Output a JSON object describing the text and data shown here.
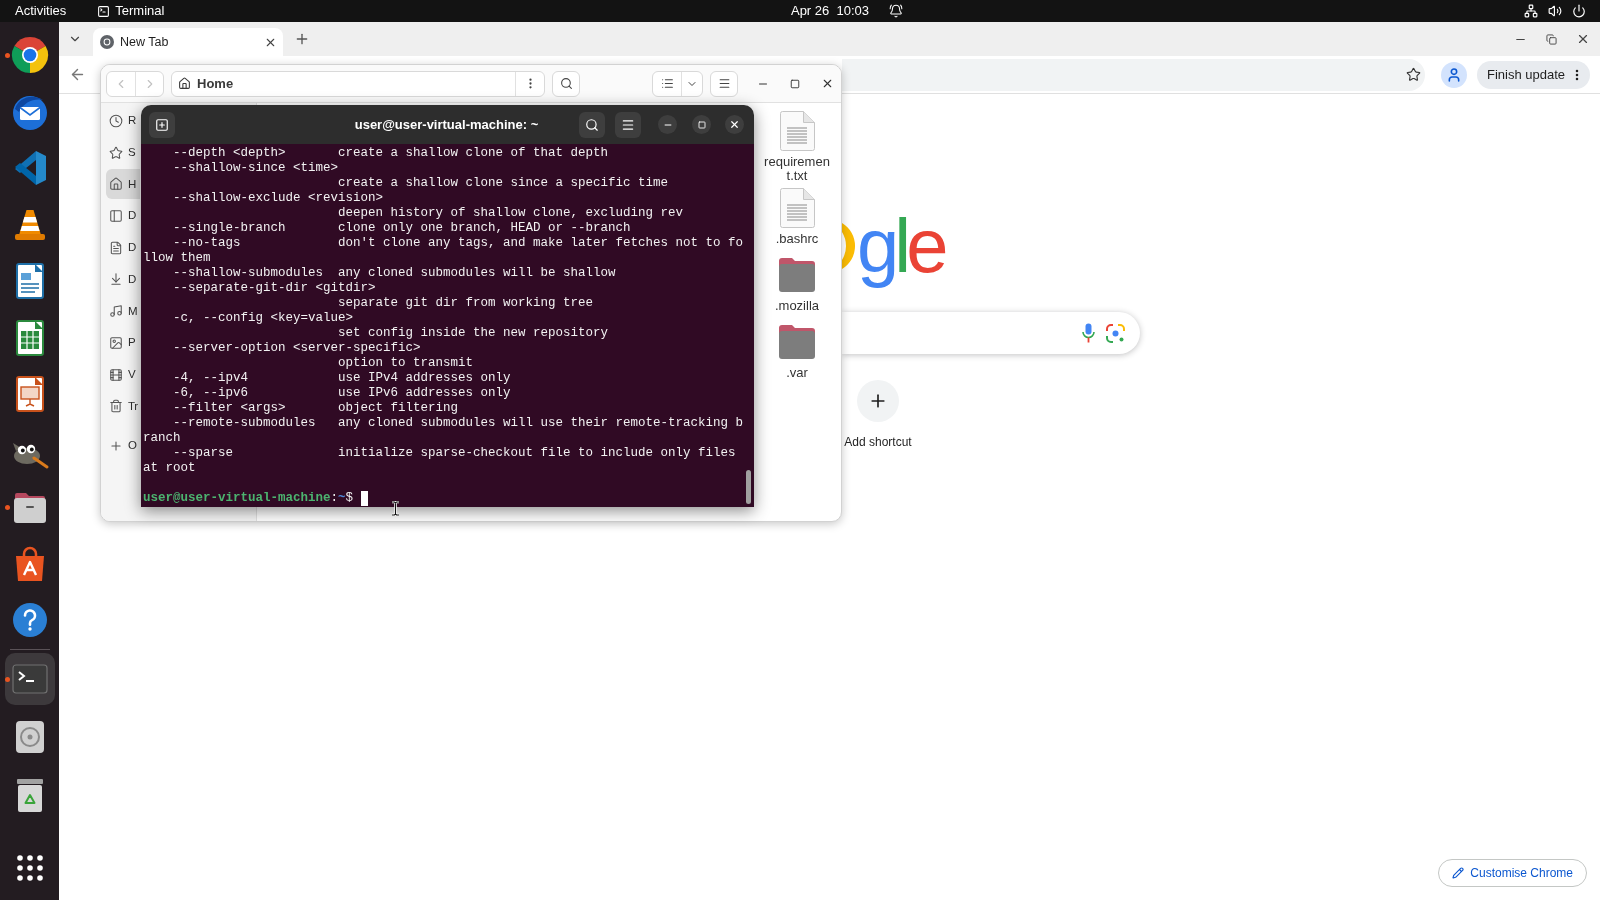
{
  "top_bar": {
    "activities": "Activities",
    "app_menu": "Terminal",
    "clock": "Apr 26  10:03"
  },
  "dock": {
    "pinned": [
      {
        "kind": "browser",
        "running": true,
        "active": false
      },
      {
        "kind": "mail",
        "running": false,
        "active": false
      },
      {
        "kind": "code_editor",
        "running": false,
        "active": false
      },
      {
        "kind": "media_player",
        "running": false,
        "active": false
      },
      {
        "kind": "writer",
        "running": false,
        "active": false
      },
      {
        "kind": "spreadsheet",
        "running": false,
        "active": false
      },
      {
        "kind": "presentation",
        "running": false,
        "active": false
      },
      {
        "kind": "image_editor",
        "running": false,
        "active": false
      },
      {
        "kind": "files",
        "running": true,
        "active": false
      },
      {
        "kind": "app_store",
        "running": false,
        "active": false
      },
      {
        "kind": "help",
        "running": false,
        "active": false
      }
    ],
    "others": [
      {
        "kind": "terminal",
        "running": true,
        "active": true
      },
      {
        "kind": "disc",
        "running": false,
        "active": false
      },
      {
        "kind": "trash",
        "running": false,
        "active": false
      }
    ]
  },
  "browser": {
    "tabs": [
      {
        "title": "New Tab",
        "selected": true
      }
    ],
    "update_button": "Finish update",
    "logo": [
      {
        "letter": "g",
        "color": "#4285f4"
      },
      {
        "letter": "l",
        "color": "#34a853"
      },
      {
        "letter": "e",
        "color": "#ea4335"
      }
    ],
    "add_shortcut": "Add shortcut",
    "customise_button": "Customise Chrome"
  },
  "files": {
    "back": {
      "disabled": true
    },
    "forward": {
      "disabled": true
    },
    "location": "Home",
    "sidebar": [
      {
        "kind": "recent",
        "label": "R",
        "selected": false
      },
      {
        "kind": "starred",
        "label": "S",
        "selected": false
      },
      {
        "kind": "home",
        "label": "H",
        "selected": true
      },
      {
        "kind": "desktop",
        "label": "D",
        "selected": false
      },
      {
        "kind": "documents",
        "label": "D",
        "selected": false
      },
      {
        "kind": "downloads",
        "label": "D",
        "selected": false
      },
      {
        "kind": "music",
        "label": "M",
        "selected": false
      },
      {
        "kind": "pictures",
        "label": "P",
        "selected": false
      },
      {
        "kind": "videos",
        "label": "V",
        "selected": false
      },
      {
        "kind": "trash",
        "label": "Tr",
        "selected": false
      },
      {
        "kind": "other",
        "label": "O",
        "selected": false
      }
    ],
    "items": [
      {
        "kind": "file",
        "name": "requirement.txt"
      },
      {
        "kind": "file",
        "name": ".bashrc"
      },
      {
        "kind": "folder",
        "name": ".mozilla"
      },
      {
        "kind": "folder",
        "name": ".var"
      }
    ]
  },
  "terminal": {
    "title": "user@user-virtual-machine: ~",
    "lines": [
      "    --depth <depth>       create a shallow clone of that depth",
      "    --shallow-since <time>",
      "                          create a shallow clone since a specific time",
      "    --shallow-exclude <revision>",
      "                          deepen history of shallow clone, excluding rev",
      "    --single-branch       clone only one branch, HEAD or --branch",
      "    --no-tags             don't clone any tags, and make later fetches not to fo",
      "llow them",
      "    --shallow-submodules  any cloned submodules will be shallow",
      "    --separate-git-dir <gitdir>",
      "                          separate git dir from working tree",
      "    -c, --config <key=value>",
      "                          set config inside the new repository",
      "    --server-option <server-specific>",
      "                          option to transmit",
      "    -4, --ipv4            use IPv4 addresses only",
      "    -6, --ipv6            use IPv6 addresses only",
      "    --filter <args>       object filtering",
      "    --remote-submodules   any cloned submodules will use their remote-tracking b",
      "ranch",
      "    --sparse              initialize sparse-checkout file to include only files",
      "at root"
    ],
    "prompt": {
      "user_host": "user@user-virtual-machine",
      "separator": ":",
      "path": "~",
      "symbol": "$"
    }
  }
}
